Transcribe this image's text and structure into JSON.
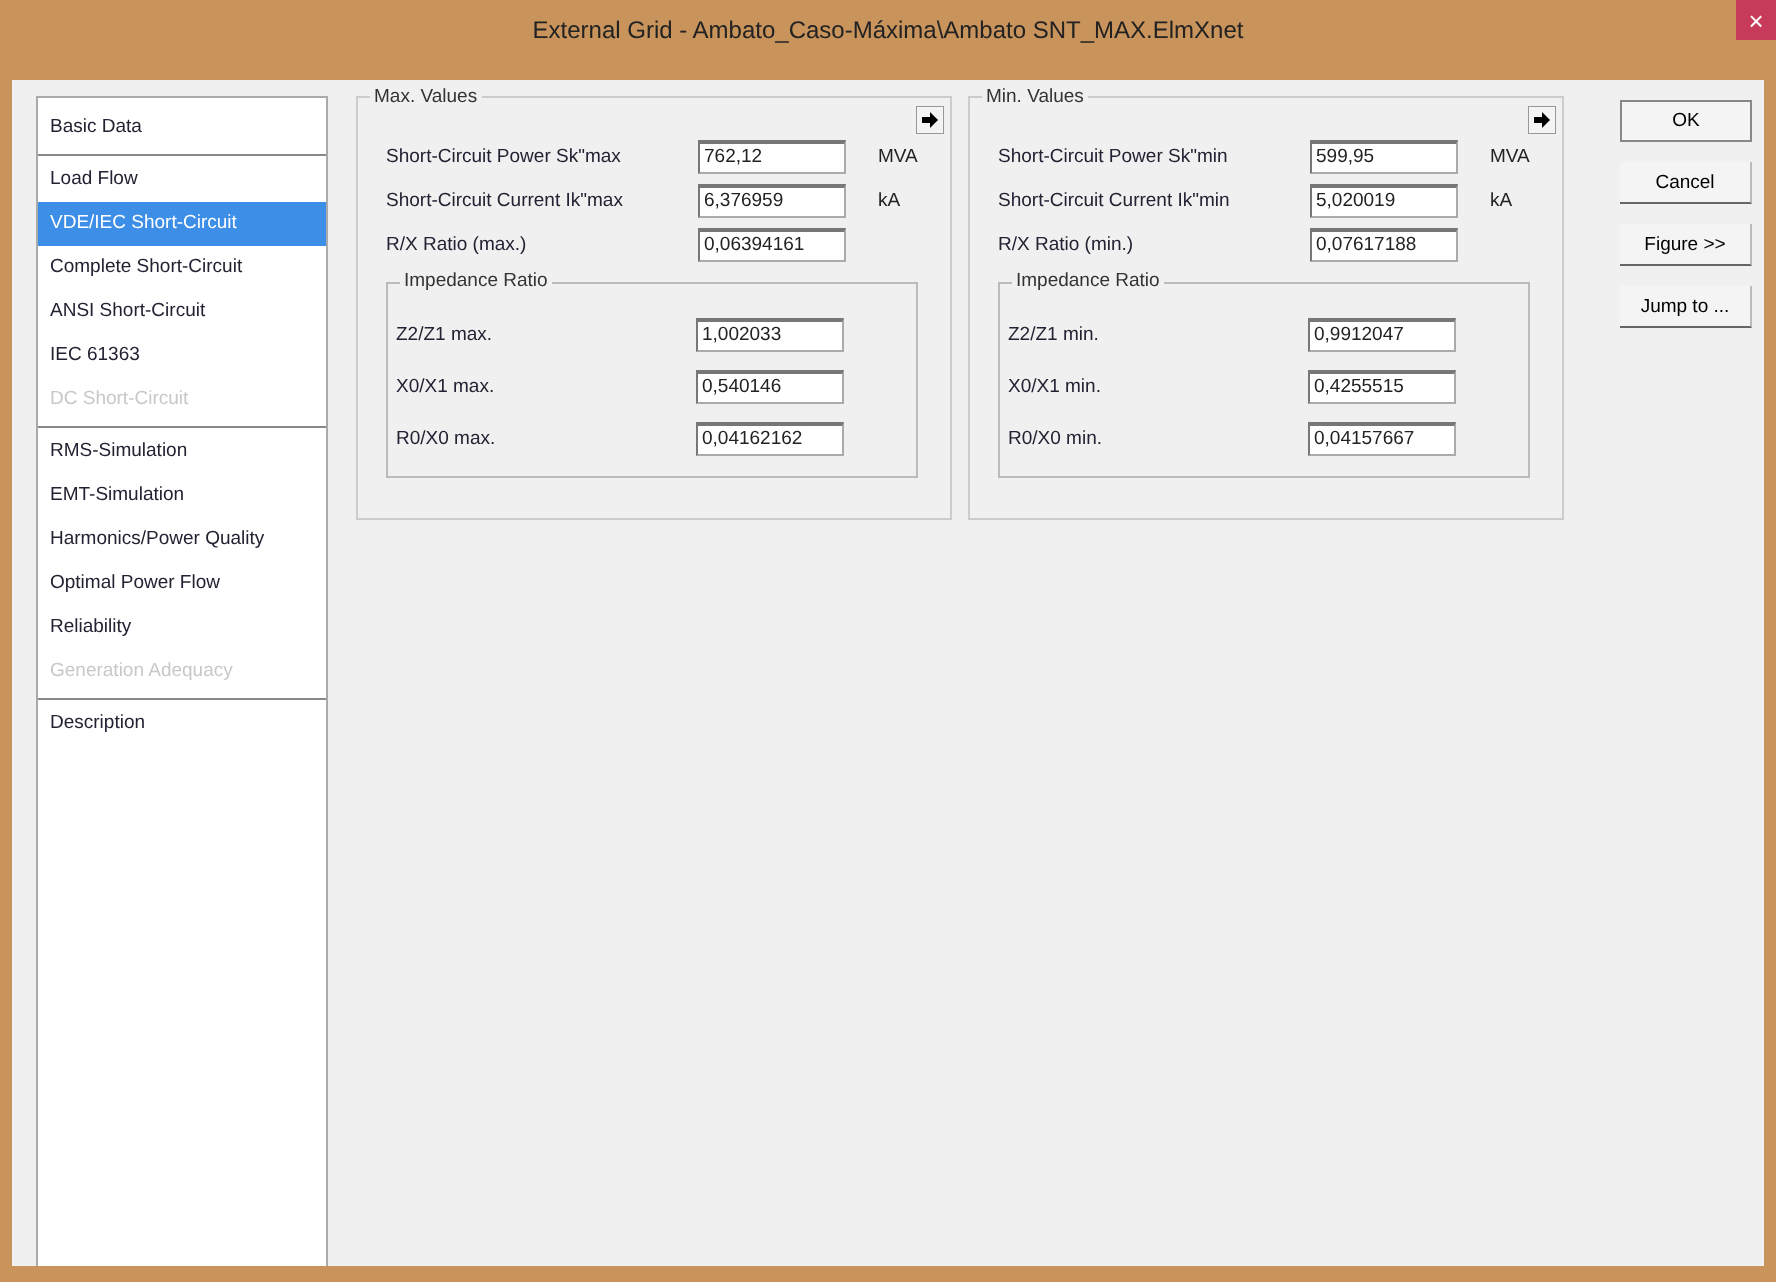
{
  "window": {
    "title": "External Grid - Ambato_Caso-Máxima\\Ambato SNT_MAX.ElmXnet",
    "close": "×"
  },
  "sidebar": {
    "groups": [
      {
        "items": [
          {
            "label": "Basic Data",
            "selected": false,
            "disabled": false
          }
        ]
      },
      {
        "items": [
          {
            "label": "Load Flow",
            "selected": false,
            "disabled": false
          },
          {
            "label": "VDE/IEC Short-Circuit",
            "selected": true,
            "disabled": false
          },
          {
            "label": "Complete Short-Circuit",
            "selected": false,
            "disabled": false
          },
          {
            "label": "ANSI Short-Circuit",
            "selected": false,
            "disabled": false
          },
          {
            "label": "IEC 61363",
            "selected": false,
            "disabled": false
          },
          {
            "label": "DC Short-Circuit",
            "selected": false,
            "disabled": true
          }
        ]
      },
      {
        "items": [
          {
            "label": "RMS-Simulation",
            "selected": false,
            "disabled": false
          },
          {
            "label": "EMT-Simulation",
            "selected": false,
            "disabled": false
          },
          {
            "label": "Harmonics/Power Quality",
            "selected": false,
            "disabled": false
          },
          {
            "label": "Optimal Power Flow",
            "selected": false,
            "disabled": false
          },
          {
            "label": "Reliability",
            "selected": false,
            "disabled": false
          },
          {
            "label": "Generation Adequacy",
            "selected": false,
            "disabled": true
          }
        ]
      },
      {
        "items": [
          {
            "label": "Description",
            "selected": false,
            "disabled": false
          }
        ]
      }
    ]
  },
  "groups": [
    {
      "title": "Max. Values",
      "fields": [
        {
          "label": "Short-Circuit Power Sk\"max",
          "value": "762,12",
          "unit": "MVA"
        },
        {
          "label": "Short-Circuit Current Ik\"max",
          "value": "6,376959",
          "unit": "kA"
        },
        {
          "label": "R/X Ratio (max.)",
          "value": "0,06394161"
        }
      ],
      "subgroup": {
        "title": "Impedance Ratio",
        "fields": [
          {
            "label": "Z2/Z1 max.",
            "value": "1,002033"
          },
          {
            "label": "X0/X1 max.",
            "value": "0,540146"
          },
          {
            "label": "R0/X0 max.",
            "value": "0,04162162"
          }
        ]
      }
    },
    {
      "title": "Min. Values",
      "fields": [
        {
          "label": "Short-Circuit Power Sk\"min",
          "value": "599,95",
          "unit": "MVA"
        },
        {
          "label": "Short-Circuit Current Ik\"min",
          "value": "5,020019",
          "unit": "kA"
        },
        {
          "label": "R/X Ratio (min.)",
          "value": "0,07617188"
        }
      ],
      "subgroup": {
        "title": "Impedance Ratio",
        "fields": [
          {
            "label": "Z2/Z1 min.",
            "value": "0,9912047"
          },
          {
            "label": "X0/X1 min.",
            "value": "0,4255515"
          },
          {
            "label": "R0/X0 min.",
            "value": "0,04157667"
          }
        ]
      }
    }
  ],
  "buttons": [
    "OK",
    "Cancel",
    "Figure >>",
    "Jump to ..."
  ]
}
